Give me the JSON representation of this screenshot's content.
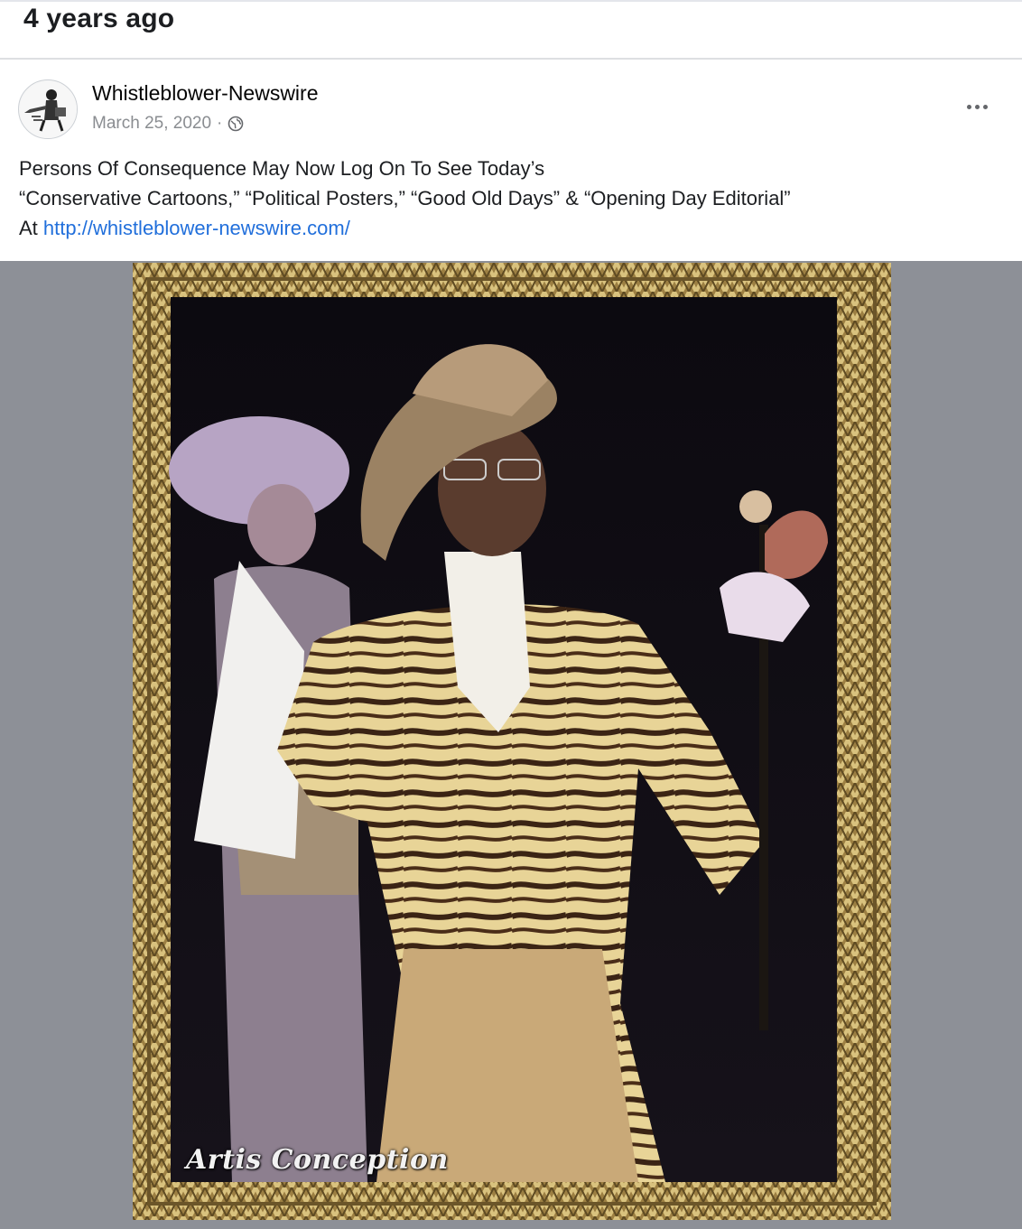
{
  "memory": {
    "title": "4 years ago"
  },
  "post": {
    "page_name": "Whistleblower-Newswire",
    "date": "March 25, 2020",
    "separator": "·",
    "privacy_icon": "globe-icon",
    "more_icon": "ellipsis-icon",
    "text_lines": [
      "Persons Of Consequence May Now Log On To See Today’s",
      "“Conservative Cartoons,” “Political Posters,” “Good Old Days” & “Opening Day Editorial”"
    ],
    "link_prefix": "At ",
    "link": "http://whistleblower-newswire.com/",
    "image": {
      "caption": "Artis Conception"
    }
  },
  "colors": {
    "link": "#216fdb",
    "meta": "#8a8d91",
    "media_background": "#8d9097",
    "frame_gold": "#b89a55"
  }
}
